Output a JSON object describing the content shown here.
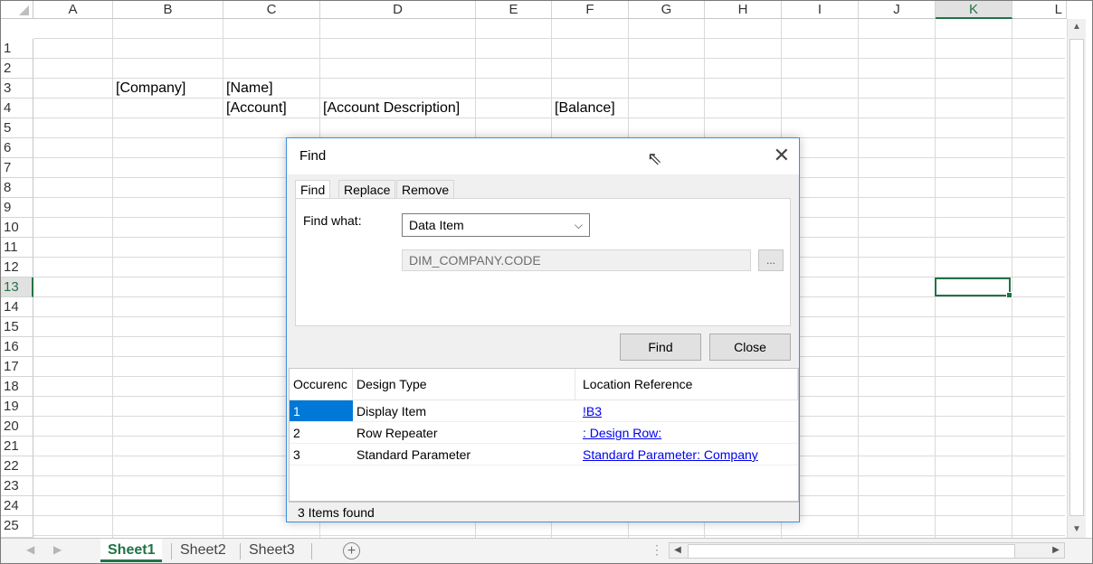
{
  "columns": [
    "A",
    "B",
    "C",
    "D",
    "E",
    "F",
    "G",
    "H",
    "I",
    "J",
    "K",
    "L"
  ],
  "selected_column": "K",
  "rows": [
    "1",
    "2",
    "3",
    "4",
    "5",
    "6",
    "7",
    "8",
    "9",
    "10",
    "11",
    "12",
    "13",
    "14",
    "15",
    "16",
    "17",
    "18",
    "19",
    "20",
    "21",
    "22",
    "23",
    "24",
    "25"
  ],
  "selected_row": "13",
  "cells": {
    "b3": "[Company]",
    "c3": "[Name]",
    "c4": "[Account]",
    "d4": "[Account Description]",
    "f4": "[Balance]"
  },
  "sheets": {
    "tabs": [
      "Sheet1",
      "Sheet2",
      "Sheet3"
    ],
    "active": "Sheet1"
  },
  "dialog": {
    "title": "Find",
    "tabs": [
      "Find",
      "Replace",
      "Remove"
    ],
    "find_what_label": "Find what:",
    "find_what_value": "Data Item",
    "data_item_field": "DIM_COMPANY.CODE",
    "browse_label": "...",
    "find_button": "Find",
    "close_button": "Close",
    "results": {
      "headers": [
        "Occurenc",
        "Design Type",
        "Location Reference"
      ],
      "rows": [
        {
          "num": "1",
          "type": "Display Item",
          "ref": "!B3"
        },
        {
          "num": "2",
          "type": "Row Repeater",
          "ref": ": Design Row:"
        },
        {
          "num": "3",
          "type": "Standard Parameter",
          "ref": "Standard Parameter: Company"
        }
      ]
    },
    "status": "3  Items found"
  },
  "colors": {
    "accent": "#217346",
    "dialog_border": "#3c8ee0",
    "selection": "#0078d7",
    "link": "#0000ee"
  }
}
